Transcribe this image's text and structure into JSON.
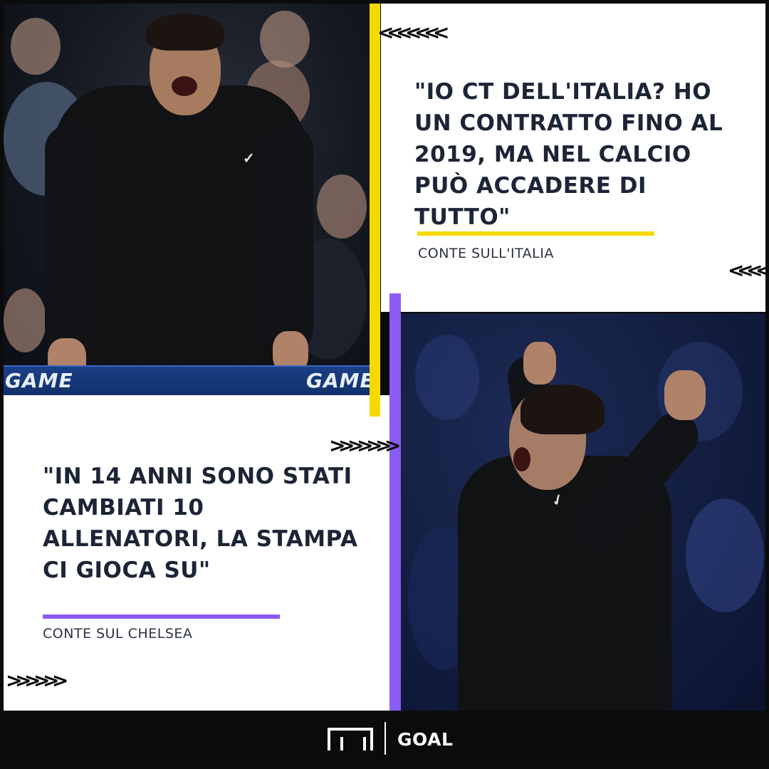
{
  "quotes": {
    "top": {
      "text": "\"IO CT DELL'ITALIA? HO UN CONTRATTO FINO AL 2019, MA NEL CALCIO PUÒ ACCADERE DI TUTTO\"",
      "attribution": "CONTE SULL'ITALIA",
      "accent_color": "#f6d900"
    },
    "bottom": {
      "text": "\"IN 14 ANNI SONO STATI CAMBIATI 10 ALLENATORI, LA STAMPA CI GIOCA SU\"",
      "attribution": "CONTE SUL CHELSEA",
      "accent_color": "#8a5cf6"
    }
  },
  "photo_top": {
    "ad_board_left": "GAME",
    "ad_board_right": "GAME",
    "icon": "nike-swoosh-icon"
  },
  "photo_bottom": {
    "icon": "nike-swoosh-icon"
  },
  "decorations": {
    "chevrons_top_left": "<<<<<<<",
    "chevrons_right": "<<<<",
    "chevrons_middle": ">>>>>>>",
    "chevrons_bottom_left": ">>>>>>"
  },
  "footer": {
    "brand": "GOAL",
    "logo_icon": "goal-logo-icon"
  },
  "colors": {
    "yellow": "#f6d900",
    "purple": "#8a5cf6",
    "background": "#0b0b0b",
    "text": "#1c2436"
  }
}
